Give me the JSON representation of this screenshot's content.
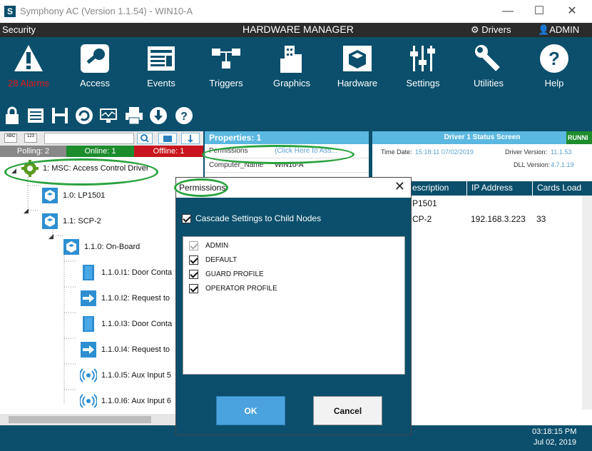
{
  "window": {
    "app_name": "Symphony AC",
    "title": "Symphony AC  (Version 1.1.54) - WIN10-A",
    "controls": {
      "minimize": "—",
      "maximize": "☐",
      "close": "✕"
    }
  },
  "menubar": {
    "section": "Security",
    "center_title": "HARDWARE MANAGER",
    "drivers": "Drivers",
    "user": "ADMIN"
  },
  "toolbar": {
    "items": [
      {
        "label": "28 Alarms",
        "icon": "alarm-warning-icon"
      },
      {
        "label": "Access",
        "icon": "key-icon"
      },
      {
        "label": "Events",
        "icon": "events-list-icon"
      },
      {
        "label": "Triggers",
        "icon": "triggers-icon"
      },
      {
        "label": "Graphics",
        "icon": "graphics-building-icon"
      },
      {
        "label": "Hardware",
        "icon": "hardware-box-icon"
      },
      {
        "label": "Settings",
        "icon": "sliders-icon"
      },
      {
        "label": "Utilities",
        "icon": "wrench-icon"
      },
      {
        "label": "Help",
        "icon": "help-icon"
      }
    ],
    "small_icons": [
      "lock-icon",
      "list-icon",
      "save-icon",
      "refresh-icon",
      "monitor-icon",
      "printer-icon",
      "download-icon",
      "help-small-icon"
    ]
  },
  "tree_panel": {
    "status": {
      "polling": "Polling:  2",
      "online": "Online:  1",
      "offline": "Offline:  1"
    },
    "nodes": [
      {
        "label": "1:  MSC: Access Control Driver",
        "icon": "gear-icon"
      },
      {
        "label": "1.0:  LP1501",
        "icon": "panel-cube-icon"
      },
      {
        "label": "1.1:  SCP-2",
        "icon": "panel-cube-icon"
      },
      {
        "label": "1.1.0:  On-Board",
        "icon": "panel-cube-icon"
      },
      {
        "label": "1.1.0.I1:  Door Conta",
        "icon": "door-icon"
      },
      {
        "label": "1.1.0.I2:  Request to",
        "icon": "exit-arrow-icon"
      },
      {
        "label": "1.1.0.I3:  Door Conta",
        "icon": "door-icon"
      },
      {
        "label": "1.1.0.I4:  Request to",
        "icon": "exit-arrow-icon"
      },
      {
        "label": "1.1.0.I5:  Aux Input 5",
        "icon": "wireless-icon"
      },
      {
        "label": "1.1.0.I6:  Aux Input 6",
        "icon": "wireless-icon"
      }
    ]
  },
  "properties": {
    "header": "Properties:  1",
    "rows": [
      {
        "key": "Permissions",
        "value": "(Click Here to Ass..."
      },
      {
        "key": "Computer_Name",
        "value": "WIN10-A"
      }
    ]
  },
  "status_screen": {
    "header": "Driver 1 Status Screen",
    "running": "RUNNI",
    "time_date": "Time Date:",
    "time_value": "15:18:11  07/02/2019",
    "driver_version_label": "Driver Version:",
    "driver_version": "11.1.53",
    "dll_version_label": "DLL Version:",
    "dll_version": "4.7.1.19",
    "columns": [
      "escription",
      "IP Address",
      "Cards Load"
    ],
    "rows": [
      {
        "desc": "P1501",
        "ip": "",
        "cards": ""
      },
      {
        "desc": "CP-2",
        "ip": "192.168.3.223",
        "cards": "33"
      }
    ]
  },
  "dialog": {
    "title": "Permissions",
    "close": "✕",
    "cascade_label": "Cascade Settings to Child Nodes",
    "items": [
      {
        "label": "ADMIN",
        "checked": true,
        "disabled": true
      },
      {
        "label": "DEFAULT",
        "checked": true,
        "disabled": false
      },
      {
        "label": "GUARD PROFILE",
        "checked": true,
        "disabled": false
      },
      {
        "label": "OPERATOR PROFILE",
        "checked": true,
        "disabled": false
      }
    ],
    "ok_label": "OK",
    "cancel_label": "Cancel"
  },
  "footer": {
    "time": "03:18:15 PM",
    "date": "Jul 02, 2019"
  },
  "colors": {
    "main_bg": "#0b4f6c",
    "accent_blue": "#5bb8e0",
    "online": "#1d8c2d",
    "offline": "#c8141e",
    "highlight": "#2aa23e",
    "alarm_text": "#e21a1a"
  }
}
